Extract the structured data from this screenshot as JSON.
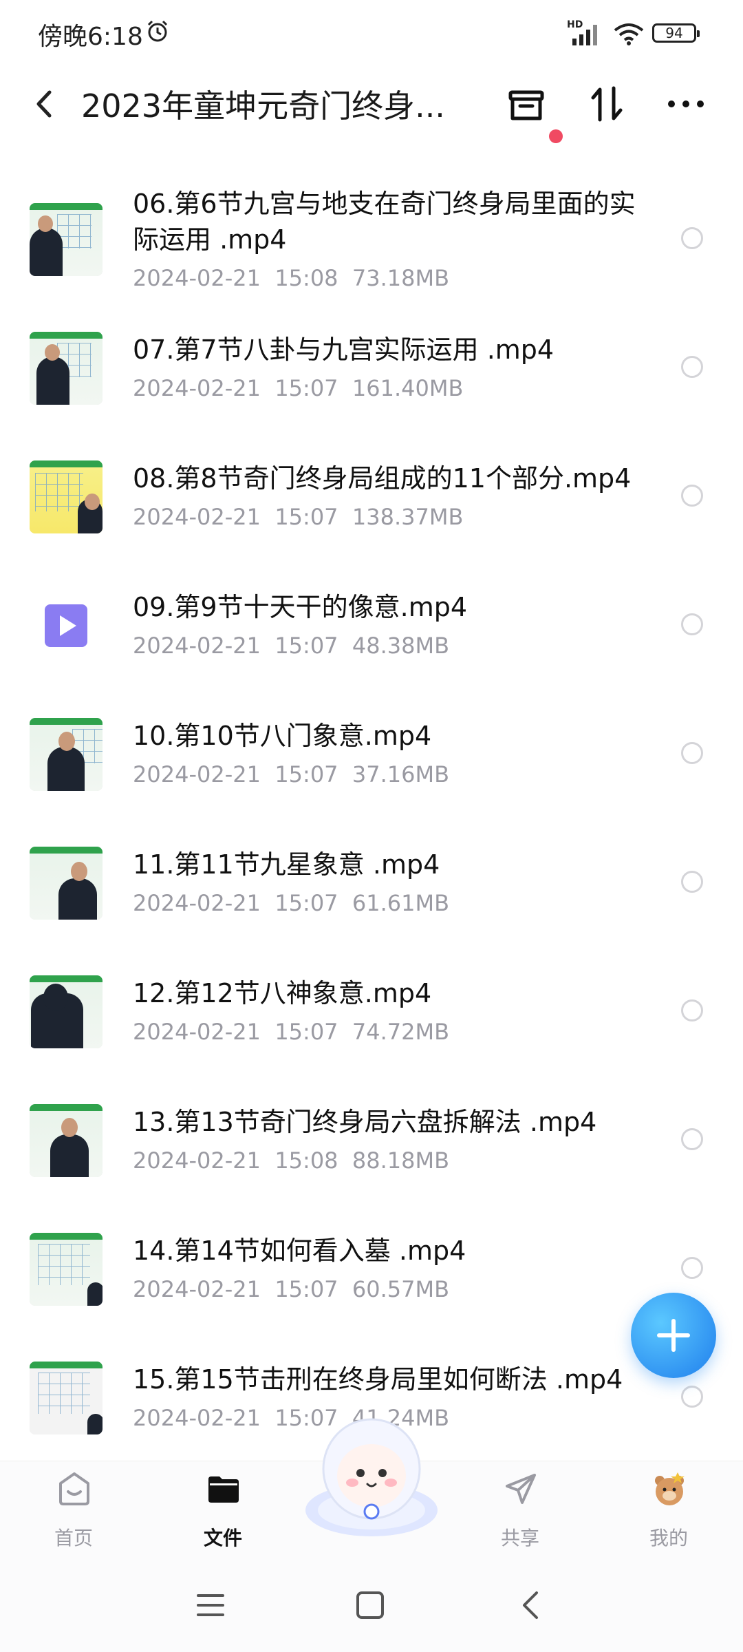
{
  "status_bar": {
    "time": "傍晚6:18",
    "network": "HD",
    "battery": "94"
  },
  "header": {
    "title": "2023年童坤元奇门终身...",
    "back_label": "back",
    "trash_icon": "recycle-bin-icon",
    "sort_icon": "sort-icon",
    "more_icon": "more-icon",
    "badge_color": "#f04a62"
  },
  "files": [
    {
      "name": "06.第6节九宫与地支在奇门终身局里面的实际运用 .mp4",
      "date": "2024-02-21",
      "time": "15:08",
      "size": "73.18MB",
      "thumb": "lecture-grid"
    },
    {
      "name": "07.第7节八卦与九宫实际运用 .mp4",
      "date": "2024-02-21",
      "time": "15:07",
      "size": "161.40MB",
      "thumb": "lecture-grid"
    },
    {
      "name": "08.第8节奇门终身局组成的11个部分.mp4",
      "date": "2024-02-21",
      "time": "15:07",
      "size": "138.37MB",
      "thumb": "lecture-table"
    },
    {
      "name": "09.第9节十天干的像意.mp4",
      "date": "2024-02-21",
      "time": "15:07",
      "size": "48.38MB",
      "thumb": "video-icon"
    },
    {
      "name": "10.第10节八门象意.mp4",
      "date": "2024-02-21",
      "time": "15:07",
      "size": "37.16MB",
      "thumb": "lecture-person"
    },
    {
      "name": "11.第11节九星象意 .mp4",
      "date": "2024-02-21",
      "time": "15:07",
      "size": "61.61MB",
      "thumb": "lecture-person"
    },
    {
      "name": "12.第12节八神象意.mp4",
      "date": "2024-02-21",
      "time": "15:07",
      "size": "74.72MB",
      "thumb": "lecture-back"
    },
    {
      "name": "13.第13节奇门终身局六盘拆解法 .mp4",
      "date": "2024-02-21",
      "time": "15:08",
      "size": "88.18MB",
      "thumb": "lecture-person"
    },
    {
      "name": "14.第14节如何看入墓 .mp4",
      "date": "2024-02-21",
      "time": "15:07",
      "size": "60.57MB",
      "thumb": "lecture-grid"
    },
    {
      "name": "15.第15节击刑在终身局里如何断法 .mp4",
      "date": "2024-02-21",
      "time": "15:07",
      "size": "41.24MB",
      "thumb": "lecture-grid"
    }
  ],
  "fab": {
    "icon": "plus-icon",
    "color": "#2b8df0"
  },
  "bottom_nav": {
    "home": "首页",
    "files": "文件",
    "share": "共享",
    "mine": "我的"
  },
  "system_nav": {
    "menu_icon": "menu-icon",
    "home_icon": "home-square-icon",
    "back_icon": "back-chevron-icon"
  }
}
